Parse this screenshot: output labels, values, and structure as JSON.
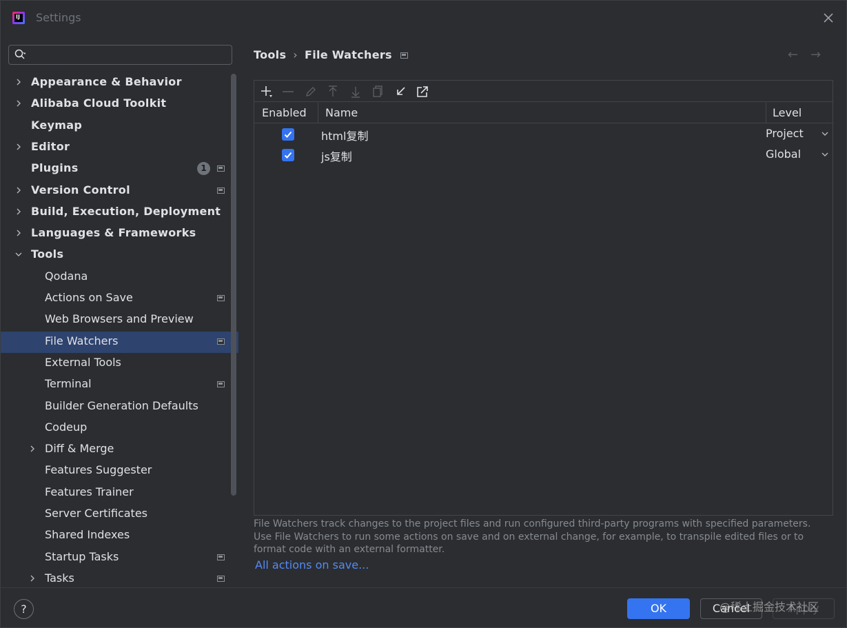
{
  "window": {
    "title": "Settings",
    "app_icon_letter": "IJ"
  },
  "search": {
    "placeholder": "",
    "value": ""
  },
  "tree": {
    "items": [
      {
        "label": "Appearance & Behavior",
        "level": 0,
        "expandable": true,
        "expanded": false,
        "bold": true
      },
      {
        "label": "Alibaba Cloud Toolkit",
        "level": 0,
        "expandable": true,
        "expanded": false,
        "bold": true
      },
      {
        "label": "Keymap",
        "level": 0,
        "expandable": false,
        "bold": true
      },
      {
        "label": "Editor",
        "level": 0,
        "expandable": true,
        "expanded": false,
        "bold": true
      },
      {
        "label": "Plugins",
        "level": 0,
        "expandable": false,
        "bold": true,
        "badge": "1",
        "project_icon": true
      },
      {
        "label": "Version Control",
        "level": 0,
        "expandable": true,
        "expanded": false,
        "bold": true,
        "project_icon": true
      },
      {
        "label": "Build, Execution, Deployment",
        "level": 0,
        "expandable": true,
        "expanded": false,
        "bold": true
      },
      {
        "label": "Languages & Frameworks",
        "level": 0,
        "expandable": true,
        "expanded": false,
        "bold": true
      },
      {
        "label": "Tools",
        "level": 0,
        "expandable": true,
        "expanded": true,
        "bold": true
      },
      {
        "label": "Qodana",
        "level": 1,
        "expandable": false
      },
      {
        "label": "Actions on Save",
        "level": 1,
        "expandable": false,
        "project_icon": true
      },
      {
        "label": "Web Browsers and Preview",
        "level": 1,
        "expandable": false
      },
      {
        "label": "File Watchers",
        "level": 1,
        "expandable": false,
        "project_icon": true,
        "selected": true
      },
      {
        "label": "External Tools",
        "level": 1,
        "expandable": false
      },
      {
        "label": "Terminal",
        "level": 1,
        "expandable": false,
        "project_icon": true
      },
      {
        "label": "Builder Generation Defaults",
        "level": 1,
        "expandable": false
      },
      {
        "label": "Codeup",
        "level": 1,
        "expandable": false
      },
      {
        "label": "Diff & Merge",
        "level": 1,
        "expandable": true,
        "expanded": false
      },
      {
        "label": "Features Suggester",
        "level": 1,
        "expandable": false
      },
      {
        "label": "Features Trainer",
        "level": 1,
        "expandable": false
      },
      {
        "label": "Server Certificates",
        "level": 1,
        "expandable": false
      },
      {
        "label": "Shared Indexes",
        "level": 1,
        "expandable": false
      },
      {
        "label": "Startup Tasks",
        "level": 1,
        "expandable": false,
        "project_icon": true
      },
      {
        "label": "Tasks",
        "level": 1,
        "expandable": true,
        "expanded": false,
        "project_icon": true
      }
    ]
  },
  "breadcrumb": {
    "parent": "Tools",
    "separator": "›",
    "current": "File Watchers"
  },
  "nav": {
    "back": "←",
    "forward": "→"
  },
  "toolbar": {
    "buttons": [
      "add-icon",
      "remove-icon",
      "edit-icon",
      "move-up-icon",
      "move-down-icon",
      "copy-icon",
      "import-icon",
      "export-icon"
    ]
  },
  "table": {
    "columns": [
      "Enabled",
      "Name",
      "Level"
    ],
    "rows": [
      {
        "enabled": true,
        "name": "html复制",
        "level": "Project"
      },
      {
        "enabled": true,
        "name": "js复制",
        "level": "Global"
      }
    ]
  },
  "description": {
    "line1": "File Watchers track changes to the project files and run configured third-party programs with specified parameters.",
    "line2": "Use File Watchers to run some actions on save and on external change, for example, to transpile edited files or to",
    "line3": "format code with an external formatter.",
    "link": "All actions on save..."
  },
  "footer": {
    "help": "?",
    "ok": "OK",
    "cancel": "Cancel",
    "apply": "Apply",
    "watermark": "@稀土掘金技术社区"
  },
  "colors": {
    "accent": "#3574f0",
    "selection": "#2e436e",
    "link": "#548af7",
    "background": "#2b2d30"
  }
}
